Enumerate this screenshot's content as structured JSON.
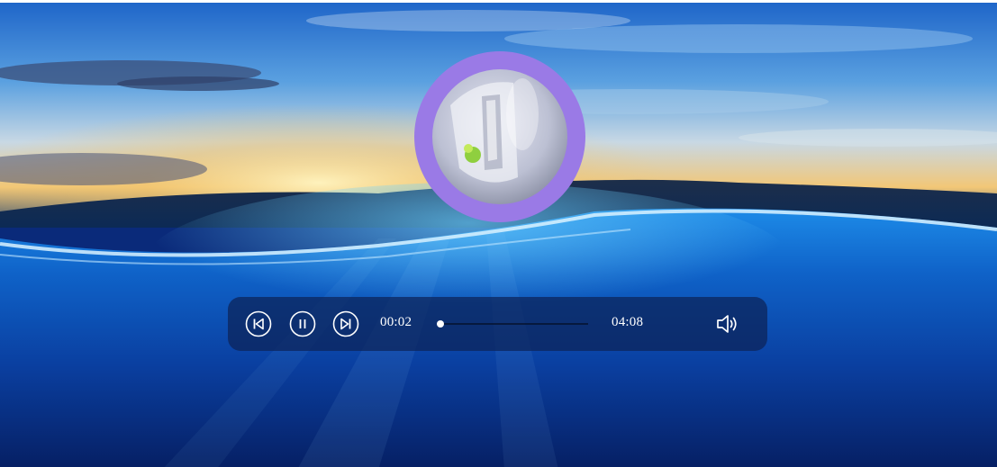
{
  "player": {
    "current_time": "00:02",
    "duration": "04:08",
    "progress_fraction": 0.008,
    "controls": {
      "previous": "previous-icon",
      "pause": "pause-icon",
      "next": "next-icon",
      "volume": "volume-icon"
    }
  },
  "colors": {
    "ring": "#9a7ae6",
    "bar_bg": "rgba(12,34,88,0.72)",
    "text": "#ffffff"
  }
}
